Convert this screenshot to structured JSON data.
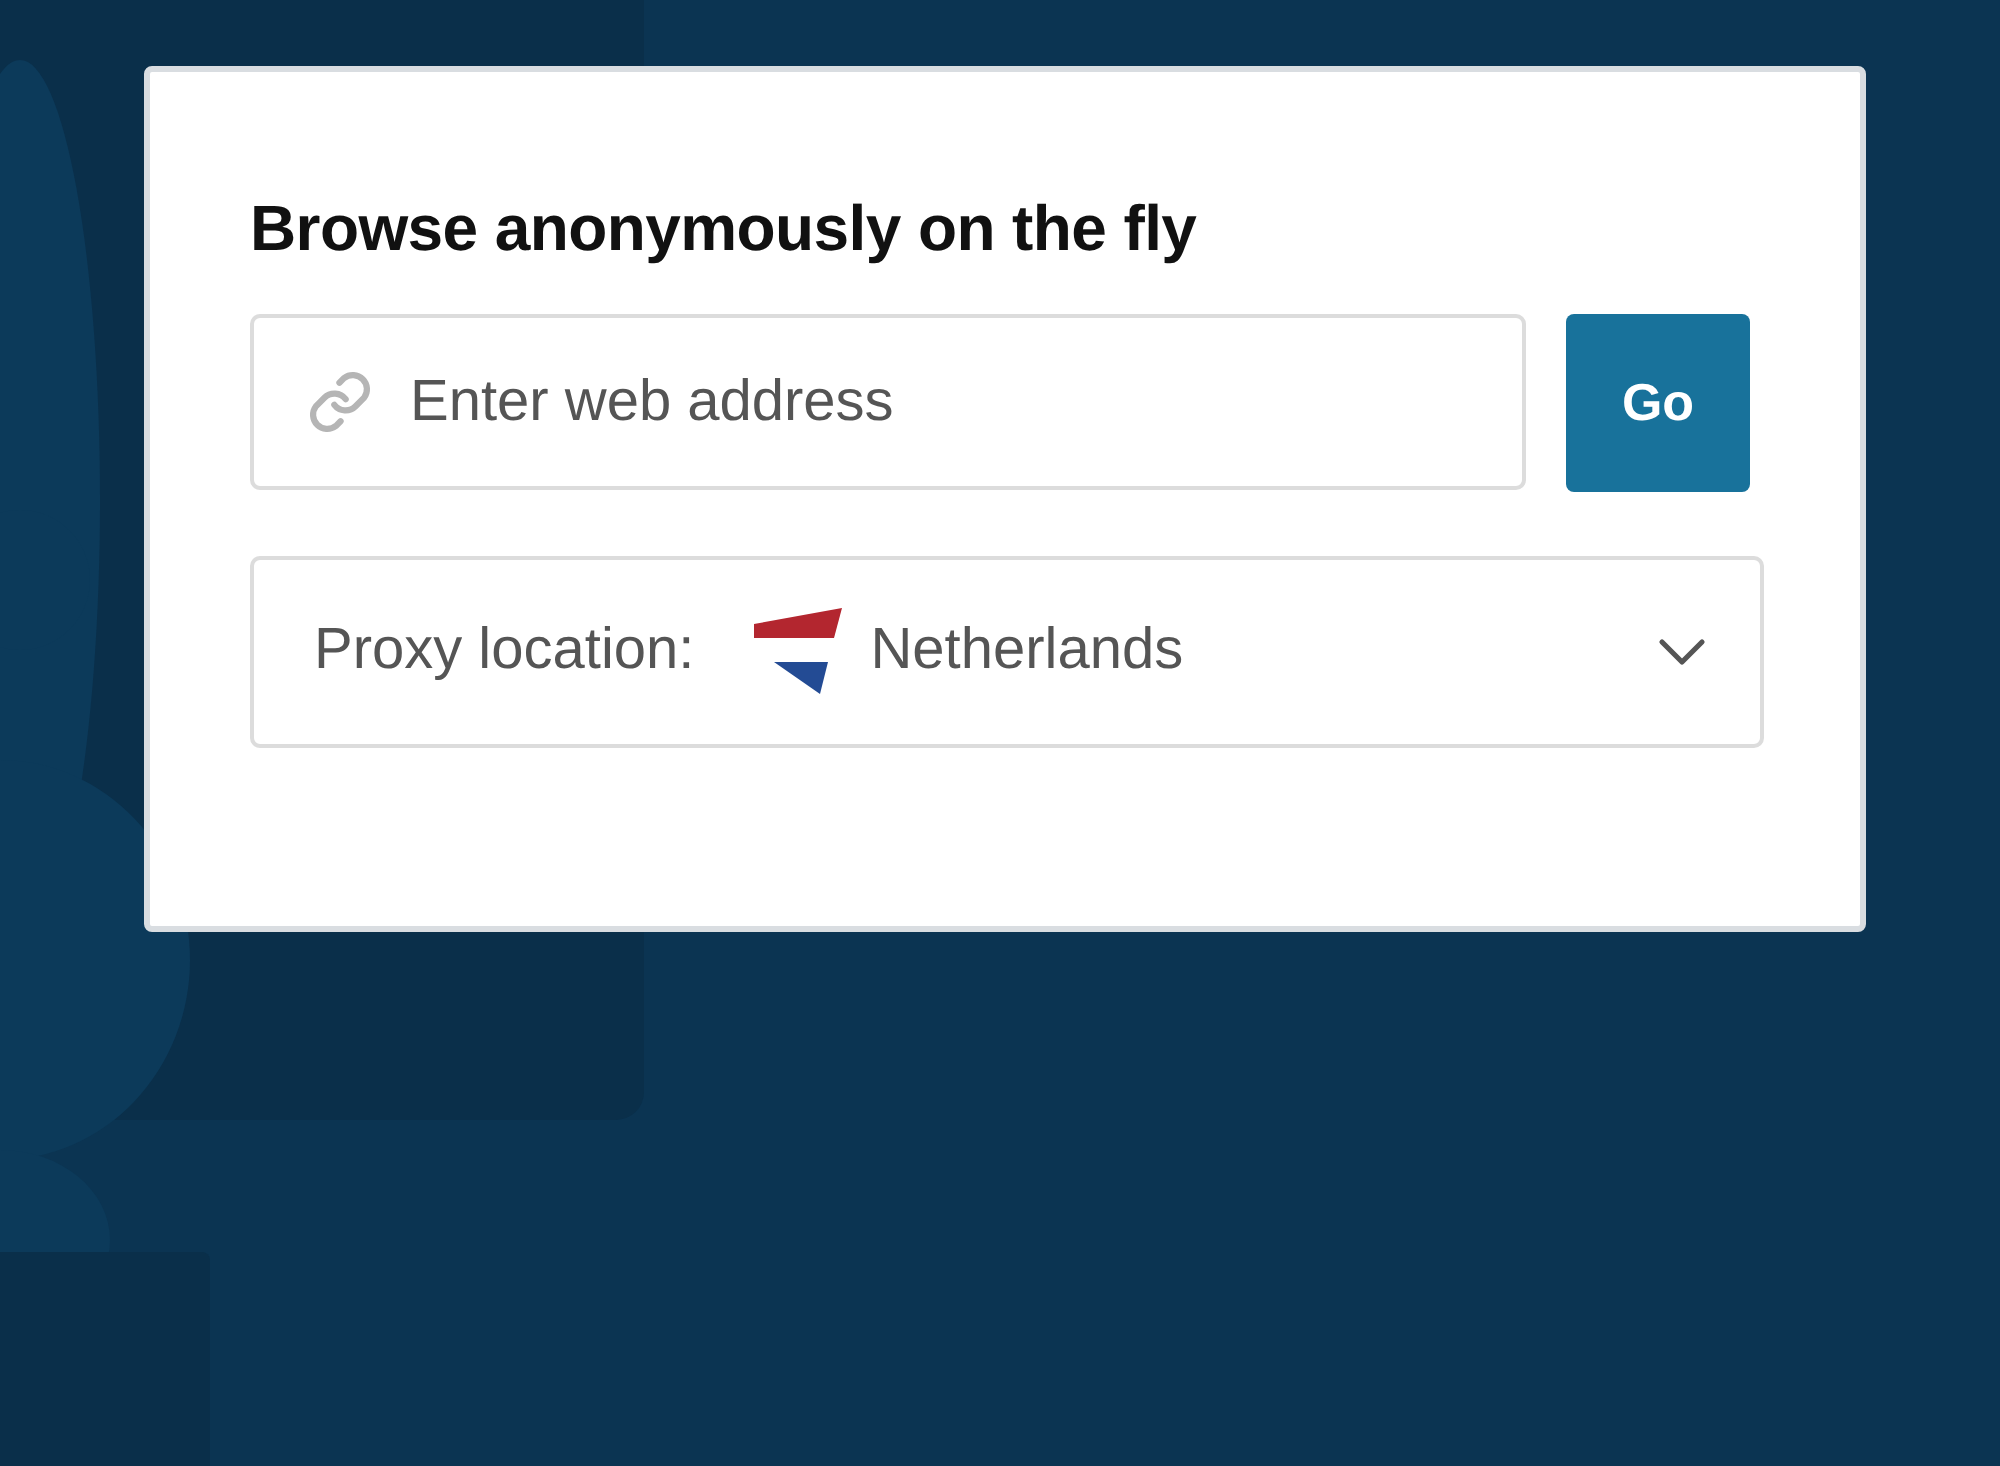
{
  "card": {
    "title": "Browse anonymously on the fly"
  },
  "address_field": {
    "placeholder": "Enter web address"
  },
  "go_button": {
    "label": "Go"
  },
  "location_select": {
    "label": "Proxy location:",
    "value": "Netherlands"
  }
}
